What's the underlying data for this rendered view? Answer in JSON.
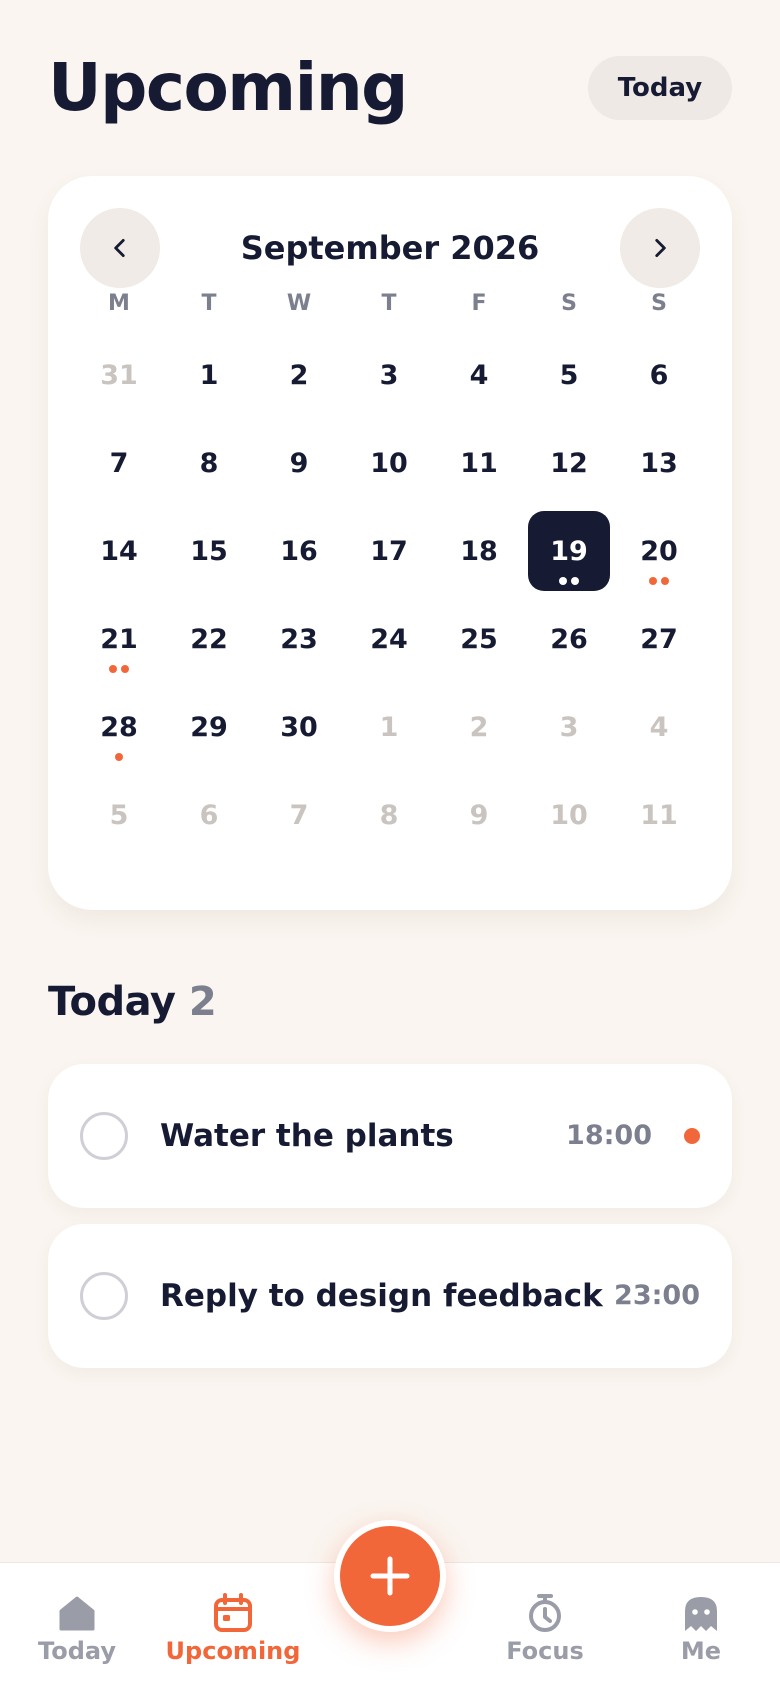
{
  "header": {
    "title": "Upcoming",
    "today_button": "Today"
  },
  "calendar": {
    "month_title": "September 2026",
    "weekdays": [
      "M",
      "T",
      "W",
      "T",
      "F",
      "S",
      "S"
    ],
    "weeks": [
      [
        {
          "d": "31",
          "m": true
        },
        {
          "d": "1"
        },
        {
          "d": "2"
        },
        {
          "d": "3"
        },
        {
          "d": "4"
        },
        {
          "d": "5"
        },
        {
          "d": "6"
        }
      ],
      [
        {
          "d": "7"
        },
        {
          "d": "8"
        },
        {
          "d": "9"
        },
        {
          "d": "10"
        },
        {
          "d": "11"
        },
        {
          "d": "12"
        },
        {
          "d": "13"
        }
      ],
      [
        {
          "d": "14"
        },
        {
          "d": "15"
        },
        {
          "d": "16"
        },
        {
          "d": "17"
        },
        {
          "d": "18"
        },
        {
          "d": "19",
          "sel": true,
          "dots": 2
        },
        {
          "d": "20",
          "dots": 2
        }
      ],
      [
        {
          "d": "21",
          "dots": 2
        },
        {
          "d": "22"
        },
        {
          "d": "23"
        },
        {
          "d": "24"
        },
        {
          "d": "25"
        },
        {
          "d": "26"
        },
        {
          "d": "27"
        }
      ],
      [
        {
          "d": "28",
          "dots": 1
        },
        {
          "d": "29"
        },
        {
          "d": "30"
        },
        {
          "d": "1",
          "m": true
        },
        {
          "d": "2",
          "m": true
        },
        {
          "d": "3",
          "m": true
        },
        {
          "d": "4",
          "m": true
        }
      ],
      [
        {
          "d": "5",
          "m": true
        },
        {
          "d": "6",
          "m": true
        },
        {
          "d": "7",
          "m": true
        },
        {
          "d": "8",
          "m": true
        },
        {
          "d": "9",
          "m": true
        },
        {
          "d": "10",
          "m": true
        },
        {
          "d": "11",
          "m": true
        }
      ]
    ]
  },
  "section": {
    "title": "Today",
    "count": "2"
  },
  "tasks": [
    {
      "title": "Water the plants",
      "time": "18:00",
      "flagged": true
    },
    {
      "title": "Reply to design feedback",
      "time": "23:00",
      "flagged": false
    }
  ],
  "nav": [
    {
      "label": "Today",
      "icon": "home-icon",
      "active": false
    },
    {
      "label": "Upcoming",
      "icon": "calendar-icon",
      "active": true
    },
    {
      "label": "Focus",
      "icon": "stopwatch-icon",
      "active": false
    },
    {
      "label": "Me",
      "icon": "ghost-icon",
      "active": false
    }
  ],
  "fab": {
    "icon": "plus-icon"
  },
  "colors": {
    "accent": "#F2673A",
    "ink": "#161B33",
    "background": "#FAF5F0",
    "muted": "#7C7F8E"
  }
}
